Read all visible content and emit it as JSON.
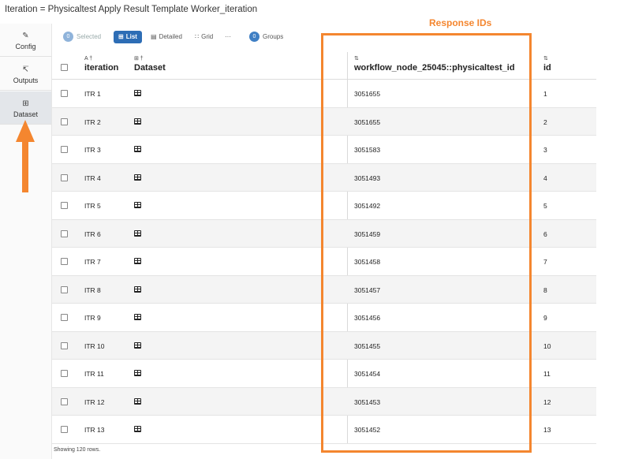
{
  "window": {
    "title": "Iteration = Physicaltest Apply Result Template Worker_iteration"
  },
  "sidebar": {
    "tabs": [
      {
        "label": "Config",
        "icon": "edit-icon"
      },
      {
        "label": "Outputs",
        "icon": "chart-icon"
      },
      {
        "label": "Dataset",
        "icon": "table-icon",
        "active": true
      }
    ]
  },
  "toolbar": {
    "selected_count": "0",
    "selected_label": "Selected",
    "list_label": "List",
    "detailed_label": "Detailed",
    "grid_label": "Grid",
    "more_label": "···",
    "groups_count": "0",
    "groups_label": "Groups"
  },
  "table": {
    "columns": [
      {
        "label": "iteration",
        "icon": "A †"
      },
      {
        "label": "Dataset",
        "icon": "⊞ †"
      },
      {
        "label": "workflow_node_25045::physicaltest_id",
        "icon": "⇅"
      },
      {
        "label": "id",
        "icon": "⇅"
      }
    ],
    "rows": [
      {
        "iteration": "ITR 1",
        "response_id": "3051655",
        "id": "1"
      },
      {
        "iteration": "ITR 2",
        "response_id": "3051655",
        "id": "2"
      },
      {
        "iteration": "ITR 3",
        "response_id": "3051583",
        "id": "3"
      },
      {
        "iteration": "ITR 4",
        "response_id": "3051493",
        "id": "4"
      },
      {
        "iteration": "ITR 5",
        "response_id": "3051492",
        "id": "5"
      },
      {
        "iteration": "ITR 6",
        "response_id": "3051459",
        "id": "6"
      },
      {
        "iteration": "ITR 7",
        "response_id": "3051458",
        "id": "7"
      },
      {
        "iteration": "ITR 8",
        "response_id": "3051457",
        "id": "8"
      },
      {
        "iteration": "ITR 9",
        "response_id": "3051456",
        "id": "9"
      },
      {
        "iteration": "ITR 10",
        "response_id": "3051455",
        "id": "10"
      },
      {
        "iteration": "ITR 11",
        "response_id": "3051454",
        "id": "11"
      },
      {
        "iteration": "ITR 12",
        "response_id": "3051453",
        "id": "12"
      },
      {
        "iteration": "ITR 13",
        "response_id": "3051452",
        "id": "13"
      }
    ],
    "footer": "Showing 120 rows."
  },
  "annotation": {
    "label": "Response IDs",
    "color": "#f4862f"
  }
}
